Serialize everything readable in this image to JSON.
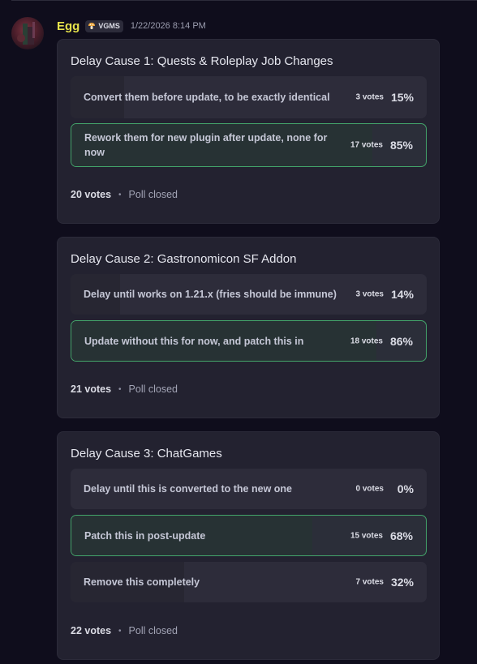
{
  "message": {
    "username": "Egg",
    "tag": {
      "icon": "mushroom-icon",
      "label": "VGMS"
    },
    "timestamp": "1/22/2026 8:14 PM",
    "avatar_icon": "avatar-image"
  },
  "polls": [
    {
      "question": "Delay Cause 1: Quests & Roleplay Job Changes",
      "answers": [
        {
          "label": "Convert them before update, to be exactly identical",
          "votes": "3 votes",
          "percent": "15%",
          "fraction": 0.15,
          "winner": false
        },
        {
          "label": "Rework them for new plugin after update, none for now",
          "votes": "17 votes",
          "percent": "85%",
          "fraction": 0.85,
          "winner": true
        }
      ],
      "total_votes": "20 votes",
      "status": "Poll closed"
    },
    {
      "question": "Delay Cause 2: Gastronomicon SF Addon",
      "answers": [
        {
          "label": "Delay until works on 1.21.x (fries should be immune)",
          "votes": "3 votes",
          "percent": "14%",
          "fraction": 0.14,
          "winner": false
        },
        {
          "label": "Update without this for now, and patch this in",
          "votes": "18 votes",
          "percent": "86%",
          "fraction": 0.86,
          "winner": true
        }
      ],
      "total_votes": "21 votes",
      "status": "Poll closed"
    },
    {
      "question": "Delay Cause 3: ChatGames",
      "answers": [
        {
          "label": "Delay until this is converted to the new one",
          "votes": "0 votes",
          "percent": "0%",
          "fraction": 0.0,
          "winner": false
        },
        {
          "label": "Patch this in post-update",
          "votes": "15 votes",
          "percent": "68%",
          "fraction": 0.68,
          "winner": true
        },
        {
          "label": "Remove this completely",
          "votes": "7 votes",
          "percent": "32%",
          "fraction": 0.32,
          "winner": false
        }
      ],
      "total_votes": "22 votes",
      "status": "Poll closed"
    }
  ],
  "colors": {
    "username": "#e5e24b",
    "winner_border": "#43a46a",
    "card_bg": "#232230",
    "page_bg": "#0f0d1c"
  }
}
